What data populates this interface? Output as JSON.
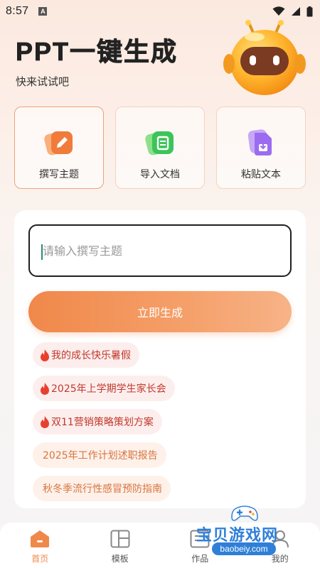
{
  "status_bar": {
    "time": "8:57",
    "a_indicator": "A",
    "icons": [
      "wifi-icon",
      "signal-icon",
      "battery-icon"
    ]
  },
  "hero": {
    "title": "PPT一键生成",
    "subtitle": "快来试试吧",
    "mascot": "robot-mascot"
  },
  "modes": [
    {
      "label": "撰写主题",
      "icon": "pencil-card-icon",
      "active": true
    },
    {
      "label": "导入文档",
      "icon": "document-import-icon",
      "active": false
    },
    {
      "label": "粘贴文本",
      "icon": "paste-file-icon",
      "active": false
    }
  ],
  "input": {
    "placeholder": "请输入撰写主题",
    "value": ""
  },
  "generate_label": "立即生成",
  "suggestions": [
    {
      "text": "我的成长快乐暑假",
      "hot": true
    },
    {
      "text": "2025年上学期学生家长会",
      "hot": true
    },
    {
      "text": "双11营销策略策划方案",
      "hot": true
    },
    {
      "text": "2025年工作计划述职报告",
      "hot": false
    },
    {
      "text": "秋冬季流行性感冒预防指南",
      "hot": false
    }
  ],
  "nav": [
    {
      "label": "首页",
      "icon": "home-icon",
      "active": true
    },
    {
      "label": "模板",
      "icon": "template-icon",
      "active": false
    },
    {
      "label": "作品",
      "icon": "works-icon",
      "active": false
    },
    {
      "label": "我的",
      "icon": "profile-icon",
      "active": false
    }
  ],
  "watermark": {
    "text": "宝贝游戏网",
    "url": "baobeiy.com"
  },
  "colors": {
    "accent": "#f0884a",
    "hot_text": "#c0392b",
    "plain_text": "#d9743f"
  }
}
